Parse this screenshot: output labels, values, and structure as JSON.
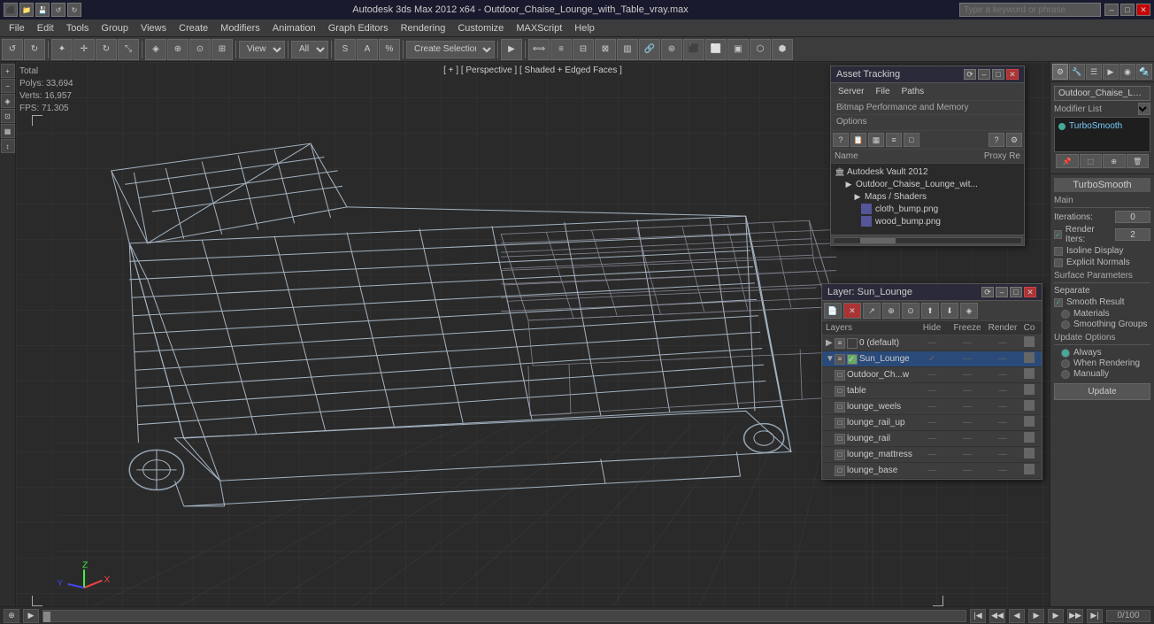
{
  "titlebar": {
    "title": "Autodesk 3ds Max 2012 x64 - Outdoor_Chaise_Lounge_with_Table_vray.max",
    "min": "–",
    "max": "□",
    "close": "✕",
    "search_placeholder": "Type a keyword or phrase"
  },
  "menubar": {
    "items": [
      "File",
      "Edit",
      "Tools",
      "Group",
      "Views",
      "Create",
      "Modifiers",
      "Animation",
      "Graph Editors",
      "Rendering",
      "Customize",
      "MAXScript",
      "Help"
    ]
  },
  "toolbar": {
    "undo_label": "↺",
    "redo_label": "↻",
    "view_label": "View",
    "all_label": "All",
    "create_selection_label": "Create Selection"
  },
  "viewport": {
    "mode_label": "[ + ] [ Perspective ] [ Shaded + Edged Faces ]",
    "stats": {
      "total_label": "Total",
      "polys_label": "Polys:",
      "polys_value": "33,694",
      "verts_label": "Verts:",
      "verts_value": "16,957",
      "fps_label": "FPS:",
      "fps_value": "71.305"
    }
  },
  "asset_panel": {
    "title": "Asset Tracking",
    "menus": [
      "Server",
      "File",
      "Paths",
      "Bitmap Performance and Memory",
      "Options"
    ],
    "col_name": "Name",
    "col_proxy": "Proxy Re",
    "tree": [
      {
        "level": 0,
        "icon": "🏛",
        "label": "Autodesk Vault 2012",
        "type": "vault"
      },
      {
        "level": 1,
        "icon": "📄",
        "label": "Outdoor_Chaise_Lounge_wit...",
        "type": "file"
      },
      {
        "level": 2,
        "icon": "📁",
        "label": "Maps / Shaders",
        "type": "folder"
      },
      {
        "level": 3,
        "icon": "🖼",
        "label": "cloth_bump.png",
        "type": "map"
      },
      {
        "level": 3,
        "icon": "🖼",
        "label": "wood_bump.png",
        "type": "map"
      }
    ]
  },
  "layer_panel": {
    "title": "Layer: Sun_Lounge",
    "header": {
      "layers": "Layers",
      "hide": "Hide",
      "freeze": "Freeze",
      "render": "Render",
      "co": "Co"
    },
    "layers": [
      {
        "name": "0 (default)",
        "indent": 0,
        "selected": false,
        "hide": "—",
        "freeze": "—",
        "render": "—"
      },
      {
        "name": "Sun_Lounge",
        "indent": 0,
        "selected": true,
        "hide": "✓",
        "freeze": "—",
        "render": "—"
      },
      {
        "name": "Outdoor_Ch...w",
        "indent": 1,
        "selected": false,
        "hide": "—",
        "freeze": "—",
        "render": "—"
      },
      {
        "name": "table",
        "indent": 1,
        "selected": false,
        "hide": "—",
        "freeze": "—",
        "render": "—"
      },
      {
        "name": "lounge_weels",
        "indent": 1,
        "selected": false,
        "hide": "—",
        "freeze": "—",
        "render": "—"
      },
      {
        "name": "lounge_rail_up",
        "indent": 1,
        "selected": false,
        "hide": "—",
        "freeze": "—",
        "render": "—"
      },
      {
        "name": "lounge_rail",
        "indent": 1,
        "selected": false,
        "hide": "—",
        "freeze": "—",
        "render": "—"
      },
      {
        "name": "lounge_mattress",
        "indent": 1,
        "selected": false,
        "hide": "—",
        "freeze": "—",
        "render": "—"
      },
      {
        "name": "lounge_base",
        "indent": 1,
        "selected": false,
        "hide": "—",
        "freeze": "—",
        "render": "—"
      }
    ]
  },
  "right_panel": {
    "obj_name": "Outdoor_Chaise_Lounge_",
    "modifier_list_label": "Modifier List",
    "modifiers": [
      {
        "name": "TurboSmooth",
        "active": true,
        "selected": true
      }
    ],
    "turbosm": {
      "title": "TurboSmooth",
      "main_label": "Main",
      "iterations_label": "Iterations:",
      "iterations_value": "0",
      "render_iters_label": "Render Iters:",
      "render_iters_value": "2",
      "isoline_label": "Isoline Display",
      "explicit_label": "Explicit Normals",
      "surface_label": "Surface Parameters",
      "separate_label": "Separate",
      "smooth_result_label": "Smooth Result",
      "materials_label": "Materials",
      "smoothing_label": "Smoothing Groups",
      "update_label": "Update Options",
      "always_label": "Always",
      "when_rendering_label": "When Rendering",
      "manually_label": "Manually",
      "update_btn": "Update"
    }
  }
}
